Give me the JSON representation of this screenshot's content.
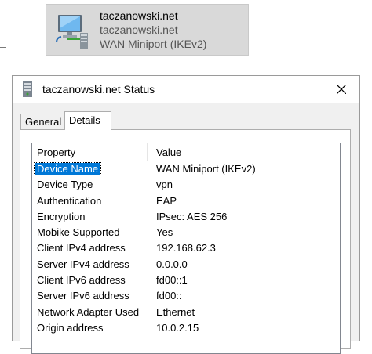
{
  "connection": {
    "name": "taczanowski.net",
    "subtitle": "taczanowski.net",
    "device": "WAN Miniport (IKEv2)"
  },
  "dialog": {
    "title": "taczanowski.net Status",
    "tabs": [
      {
        "label": "General"
      },
      {
        "label": "Details",
        "active": true
      }
    ],
    "details": {
      "headers": {
        "property": "Property",
        "value": "Value"
      },
      "rows": [
        {
          "property": "Device Name",
          "value": "WAN Miniport (IKEv2)",
          "selected": true
        },
        {
          "property": "Device Type",
          "value": "vpn"
        },
        {
          "property": "Authentication",
          "value": "EAP"
        },
        {
          "property": "Encryption",
          "value": "IPsec: AES 256"
        },
        {
          "property": "Mobike Supported",
          "value": "Yes"
        },
        {
          "property": "Client IPv4 address",
          "value": "192.168.62.3"
        },
        {
          "property": "Server IPv4 address",
          "value": "0.0.0.0"
        },
        {
          "property": "Client IPv6 address",
          "value": "fd00::1"
        },
        {
          "property": "Server IPv6 address",
          "value": "fd00::"
        },
        {
          "property": "Network Adapter Used",
          "value": "Ethernet"
        },
        {
          "property": "Origin address",
          "value": "10.0.2.15"
        }
      ]
    }
  },
  "colors": {
    "selection": "#0078d7",
    "tile_background": "#d9d9d9"
  }
}
